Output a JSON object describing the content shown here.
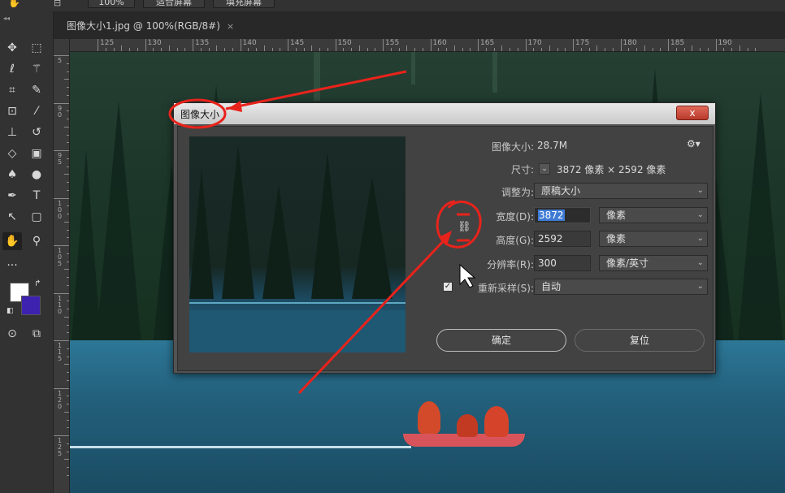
{
  "options_bar": {
    "zoom_button": "100%",
    "fit_screen_button": "适合屏幕",
    "fill_screen_button": "填充屏幕"
  },
  "document": {
    "tab_title": "图像大小1.jpg @ 100%(RGB/8#)",
    "tab_close": "×"
  },
  "ruler": {
    "top_labels": [
      "125",
      "130",
      "135",
      "140",
      "145",
      "150",
      "155",
      "160",
      "165",
      "170",
      "175",
      "180",
      "185",
      "190"
    ],
    "left_labels": [
      "5",
      "9 0",
      "9 5",
      "1 0 0",
      "1 0 5",
      "1 1 0",
      "1 1 5",
      "1 2 0",
      "1 2 5"
    ]
  },
  "colors": {
    "foreground": "#ffffff",
    "background": "#3d22b0",
    "annotation": "#e8231b"
  },
  "dialog": {
    "title": "图像大小",
    "close_symbol": "x",
    "image_size_label": "图像大小:",
    "image_size_value": "28.7M",
    "dimensions_label": "尺寸:",
    "dimensions_value": "3872 像素  ×  2592 像素",
    "fit_to_label": "调整为:",
    "fit_to_value": "原稿大小",
    "width_label": "宽度(D):",
    "width_value": "3872",
    "width_unit": "像素",
    "height_label": "高度(G):",
    "height_value": "2592",
    "height_unit": "像素",
    "resolution_label": "分辨率(R):",
    "resolution_value": "300",
    "resolution_unit": "像素/英寸",
    "resample_label": "重新采样(S):",
    "resample_value": "自动",
    "ok_button": "确定",
    "reset_button": "复位"
  },
  "icons": {
    "tools": [
      "move-icon",
      "marquee-icon",
      "lasso-icon",
      "magic-wand-icon",
      "crop-icon",
      "eyedropper-icon",
      "healing-brush-icon",
      "brush-icon",
      "stamp-icon",
      "history-brush-icon",
      "eraser-icon",
      "gradient-icon",
      "blur-icon",
      "dodge-icon",
      "pen-icon",
      "type-icon",
      "path-select-icon",
      "shape-icon",
      "hand-icon",
      "zoom-icon",
      "more-icon",
      "quick-mask-icon",
      "screen-mode-icon"
    ]
  }
}
